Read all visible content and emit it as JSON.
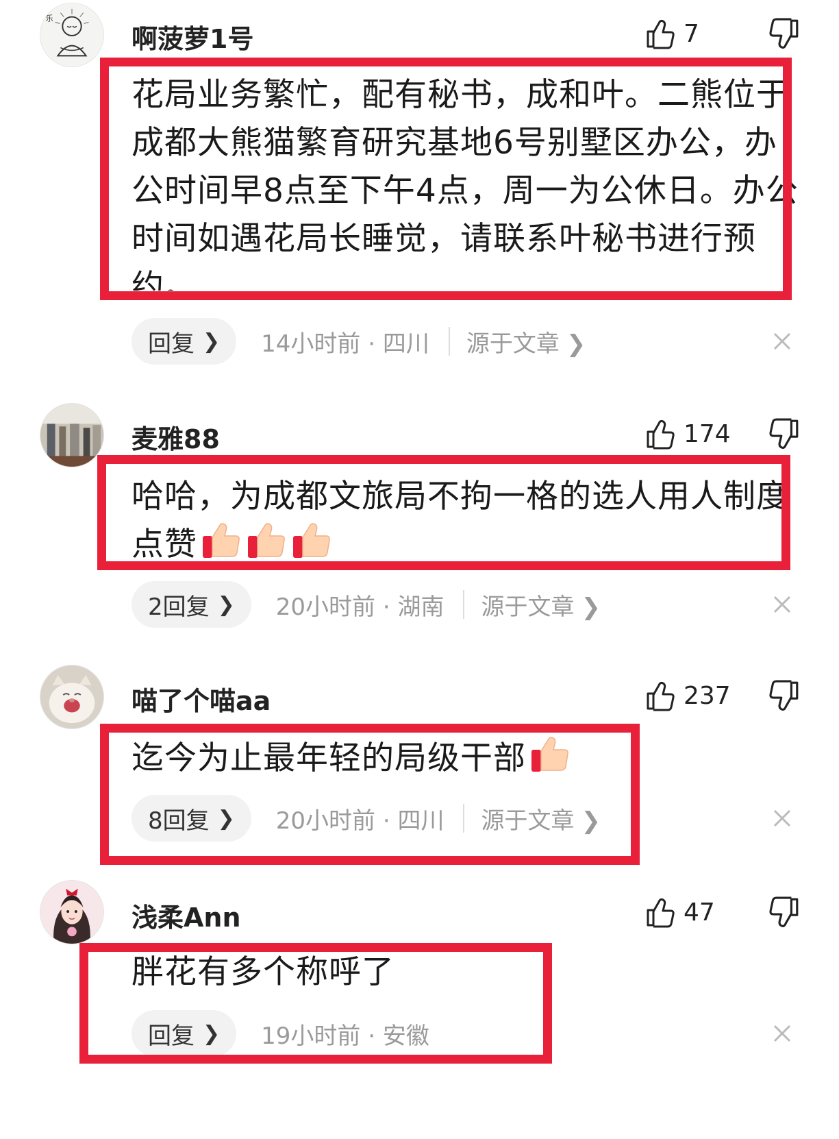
{
  "comments": [
    {
      "username": "啊菠萝1号",
      "likes": "7",
      "text": "花局业务繁忙，配有秘书，成和叶。二熊位于成都大熊猫繁育研究基地6号别墅区办公，办公时间早8点至下午4点，周一为公休日。办公时间如遇花局长睡觉，请联系叶秘书进行预约。",
      "reply_label": "回复",
      "time": "14小时前 · 四川",
      "source": "源于文章"
    },
    {
      "username": "麦雅88",
      "likes": "174",
      "text": "哈哈，为成都文旅局不拘一格的选人用人制度点赞",
      "emoji": [
        "thumbs-up",
        "thumbs-up",
        "thumbs-up"
      ],
      "reply_label": "2回复",
      "time": "20小时前 · 湖南",
      "source": "源于文章"
    },
    {
      "username": "喵了个喵aa",
      "likes": "237",
      "text": "迄今为止最年轻的局级干部",
      "emoji": [
        "thumbs-up"
      ],
      "reply_label": "8回复",
      "time": "20小时前 · 四川",
      "source": "源于文章"
    },
    {
      "username": "浅柔Ann",
      "likes": "47",
      "text": "胖花有多个称呼了",
      "reply_label": "回复",
      "time": "19小时前 · 安徽"
    }
  ],
  "icons": {
    "like": "thumbs-up-outline-icon",
    "dislike": "thumbs-down-outline-icon",
    "close": "close-icon",
    "chevron": "chevron-right-icon"
  },
  "colors": {
    "highlight_box": "#e8203a",
    "meta_text": "#9a9a9a",
    "pill_bg": "#f2f2f2"
  }
}
